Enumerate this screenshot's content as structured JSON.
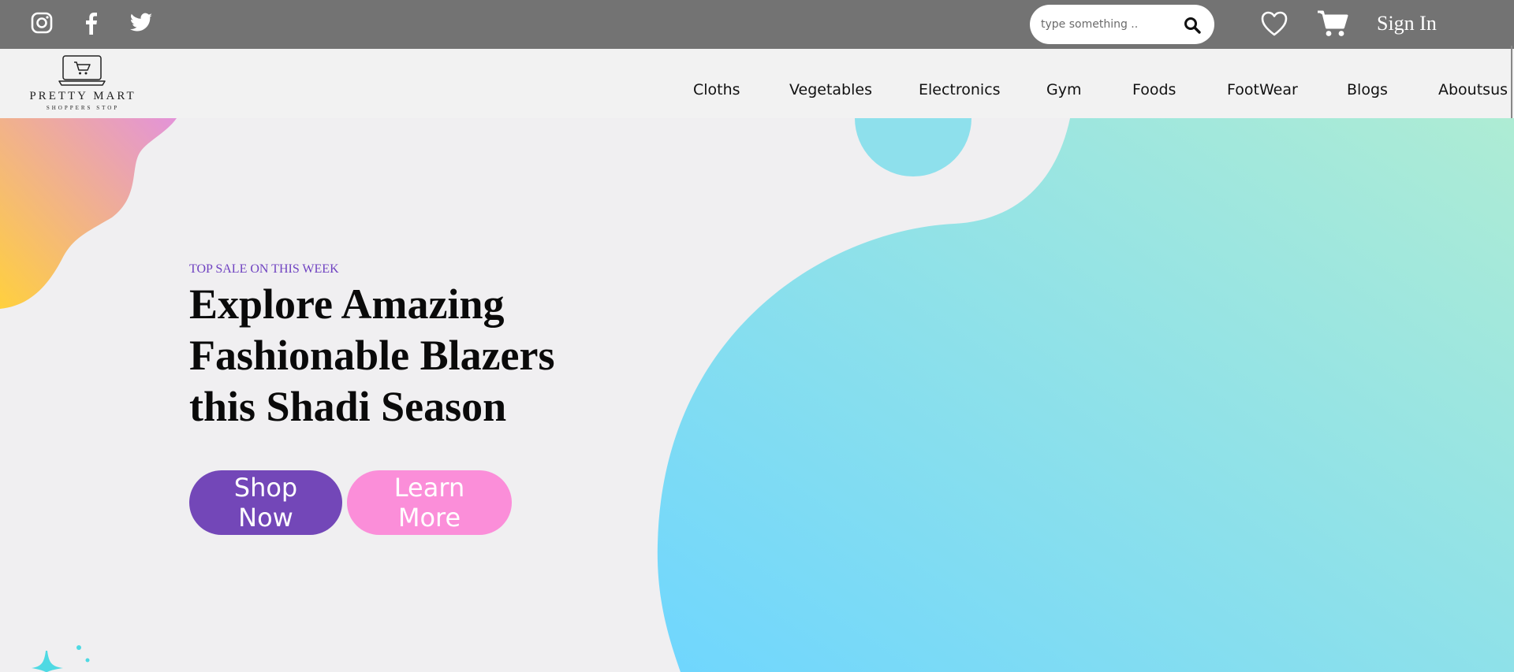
{
  "topbar": {
    "social_icons": [
      "instagram-icon",
      "facebook-icon",
      "twitter-icon"
    ],
    "search": {
      "placeholder": "type something ..",
      "value": ""
    },
    "signin_label": "Sign In",
    "icons": [
      "search-icon",
      "heart-icon",
      "cart-icon"
    ]
  },
  "brand": {
    "name": "PRETTY MART",
    "tagline": "SHOPPERS STOP"
  },
  "nav": {
    "items": [
      "Cloths",
      "Vegetables",
      "Electronics",
      "Gym",
      "Foods",
      "FootWear",
      "Blogs",
      "Aboutsus"
    ]
  },
  "hero": {
    "eyebrow": "TOP SALE ON THIS WEEK",
    "headline_lines": [
      "Explore Amazing",
      "Fashionable Blazers",
      "this Shadi Season"
    ],
    "primary_button": "Shop Now",
    "secondary_button": "Learn More"
  },
  "colors": {
    "topbar": "#737373",
    "navbar": "#f2f2f2",
    "page_bg": "#f0eff1",
    "accent_purple": "#7347b8",
    "accent_pink": "#fb8ed9",
    "blob_cyan": "#6fd6fe",
    "blob_mint": "#aeecd4",
    "blob_orange": "#ffd03e",
    "blob_pink": "#e393d9"
  }
}
